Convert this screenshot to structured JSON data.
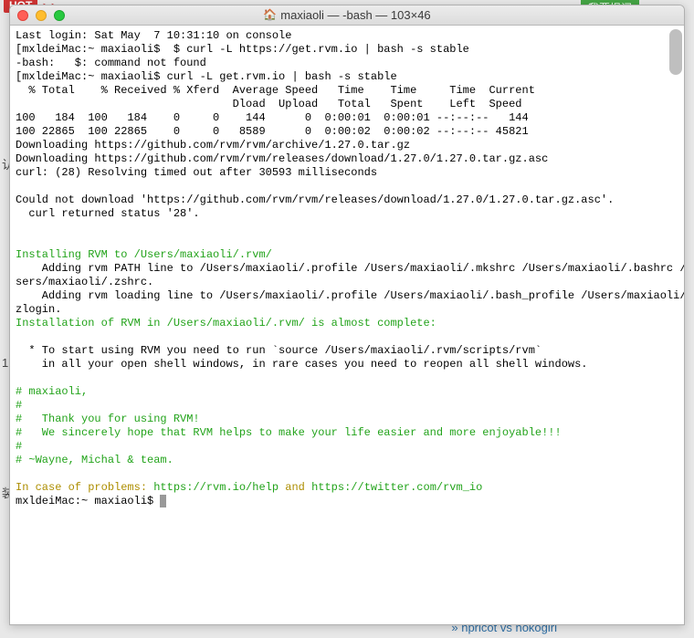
{
  "window": {
    "title": "maxiaoli — -bash — 103×46"
  },
  "background": {
    "hot": "HOT",
    "ask_btn": "我要提问",
    "left_frag_1": "认",
    "left_frag_2": "1",
    "left_frag_3": "装",
    "bottom_link": "hpricot vs nokogiri",
    "fade_red": "~!  >>>"
  },
  "term": {
    "l1": "Last login: Sat May  7 10:31:10 on console",
    "l2": "[mxldeiMac:~ maxiaoli$  $ curl -L https://get.rvm.io | bash -s stable",
    "l3": "-bash:   $: command not found",
    "l4": "[mxldeiMac:~ maxiaoli$ curl -L get.rvm.io | bash -s stable",
    "l5": "  % Total    % Received % Xferd  Average Speed   Time    Time     Time  Current",
    "l6": "                                 Dload  Upload   Total   Spent    Left  Speed",
    "l7": "100   184  100   184    0     0    144      0  0:00:01  0:00:01 --:--:--   144",
    "l8": "100 22865  100 22865    0     0   8589      0  0:00:02  0:00:02 --:--:-- 45821",
    "l9": "Downloading https://github.com/rvm/rvm/archive/1.27.0.tar.gz",
    "l10": "Downloading https://github.com/rvm/rvm/releases/download/1.27.0/1.27.0.tar.gz.asc",
    "l11": "curl: (28) Resolving timed out after 30593 milliseconds",
    "l12": "",
    "l13": "Could not download 'https://github.com/rvm/rvm/releases/download/1.27.0/1.27.0.tar.gz.asc'.",
    "l14": "  curl returned status '28'.",
    "l15": "",
    "l16": "",
    "l17": "Installing RVM to /Users/maxiaoli/.rvm/",
    "l18": "    Adding rvm PATH line to /Users/maxiaoli/.profile /Users/maxiaoli/.mkshrc /Users/maxiaoli/.bashrc /U",
    "l19": "sers/maxiaoli/.zshrc.",
    "l20": "    Adding rvm loading line to /Users/maxiaoli/.profile /Users/maxiaoli/.bash_profile /Users/maxiaoli/.",
    "l21": "zlogin.",
    "l22": "Installation of RVM in /Users/maxiaoli/.rvm/ is almost complete:",
    "l23": "",
    "l24": "  * To start using RVM you need to run `source /Users/maxiaoli/.rvm/scripts/rvm`",
    "l25": "    in all your open shell windows, in rare cases you need to reopen all shell windows.",
    "l26": "",
    "l27": "# maxiaoli,",
    "l28": "#",
    "l29": "#   Thank you for using RVM!",
    "l30": "#   We sincerely hope that RVM helps to make your life easier and more enjoyable!!!",
    "l31": "#",
    "l32": "# ~Wayne, Michal & team.",
    "l33": "",
    "help_prefix": "In case of problems: ",
    "help_link1": "https://rvm.io/help",
    "help_and": " and ",
    "help_link2": "https://twitter.com/rvm_io",
    "prompt": "mxldeiMac:~ maxiaoli$ "
  }
}
